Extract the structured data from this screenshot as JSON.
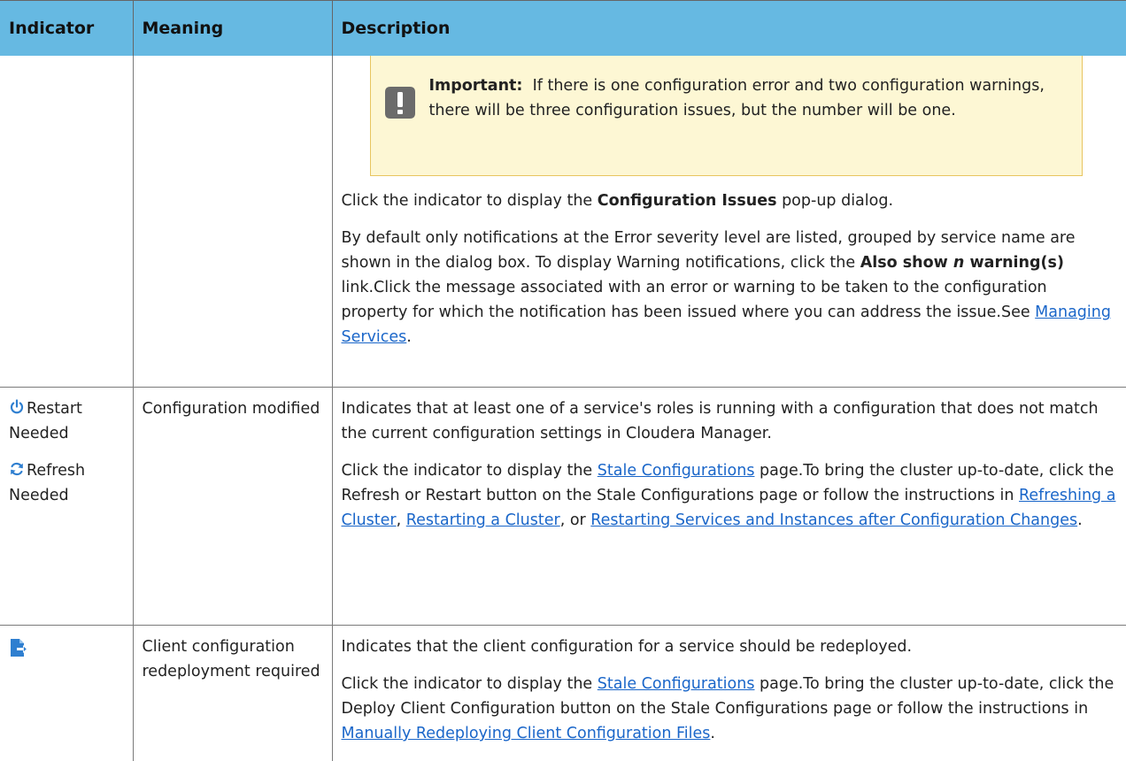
{
  "table": {
    "headers": [
      "Indicator",
      "Meaning",
      "Description"
    ],
    "row1": {
      "important_label": "Important:",
      "important_text": "If there is one configuration error and two configuration warnings, there will be three configuration issues, but the number will be one.",
      "p1_before": "Click the indicator to display the ",
      "p1_bold": "Configuration Issues",
      "p1_after": " pop-up dialog.",
      "p2_text_a": "By default only notifications at the Error severity level are listed, grouped by service name are shown in the dialog box. To display Warning notifications, click the ",
      "p2_bold_a": "Also show ",
      "p2_bold_italic": "n",
      "p2_bold_b": " warning(s)",
      "p2_text_b": " link.Click the message associated with an error or warning to be taken to the configuration property for which the notification has been issued where you can address the issue.See ",
      "p2_link": "Managing Services",
      "p2_end": "."
    },
    "row2": {
      "indicator_restart": "Restart Needed",
      "indicator_refresh": "Refresh Needed",
      "restart_icon": "power-icon",
      "refresh_icon": "refresh-icon",
      "meaning": "Configuration modified",
      "p1": "Indicates that at least one of a service's roles is running with a configuration that does not match the current configuration settings in Cloudera Manager.",
      "p2_a": "Click the indicator to display the ",
      "p2_link1": "Stale Configurations",
      "p2_b": " page.To bring the cluster up-to-date, click the Refresh or Restart button on the Stale Configurations page or follow the instructions in ",
      "p2_link2": "Refreshing a Cluster",
      "p2_c": ", ",
      "p2_link3": "Restarting a Cluster",
      "p2_d": ", or ",
      "p2_link4": "Restarting Services and Instances after Configuration Changes",
      "p2_e": "."
    },
    "row3": {
      "indicator_icon": "client-config-redeploy-icon",
      "meaning": "Client configuration redeployment required",
      "p1": "Indicates that the client configuration for a service should be redeployed.",
      "p2_a": "Click the indicator to display the ",
      "p2_link1": "Stale Configurations",
      "p2_b": " page.To bring the cluster up-to-date, click the Deploy Client Configuration button on the Stale Configurations page or follow the instructions in ",
      "p2_link2": "Manually Redeploying Client Configuration Files",
      "p2_c": "."
    }
  },
  "colors": {
    "header_bg": "#66b9e2",
    "link": "#1a66c9",
    "callout_bg": "#fdf7d4",
    "callout_border": "#e8c560",
    "icon_blue": "#2f7fd0"
  }
}
